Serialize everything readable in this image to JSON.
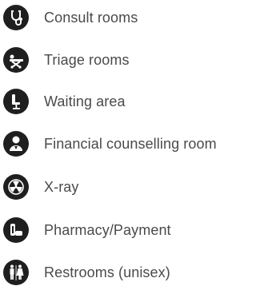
{
  "legend": {
    "items": [
      {
        "label": "Consult rooms",
        "icon": "stethoscope-icon"
      },
      {
        "label": "Triage rooms",
        "icon": "stretcher-icon"
      },
      {
        "label": "Waiting area",
        "icon": "chair-icon"
      },
      {
        "label": "Financial counselling room",
        "icon": "person-icon"
      },
      {
        "label": "X-ray",
        "icon": "radiation-icon"
      },
      {
        "label": "Pharmacy/Payment",
        "icon": "pharmacy-icon"
      },
      {
        "label": "Restrooms (unisex)",
        "icon": "restroom-icon"
      }
    ]
  },
  "colors": {
    "icon_fill": "#1f1f1f",
    "text": "#4a4a4a",
    "background": "#ffffff"
  }
}
